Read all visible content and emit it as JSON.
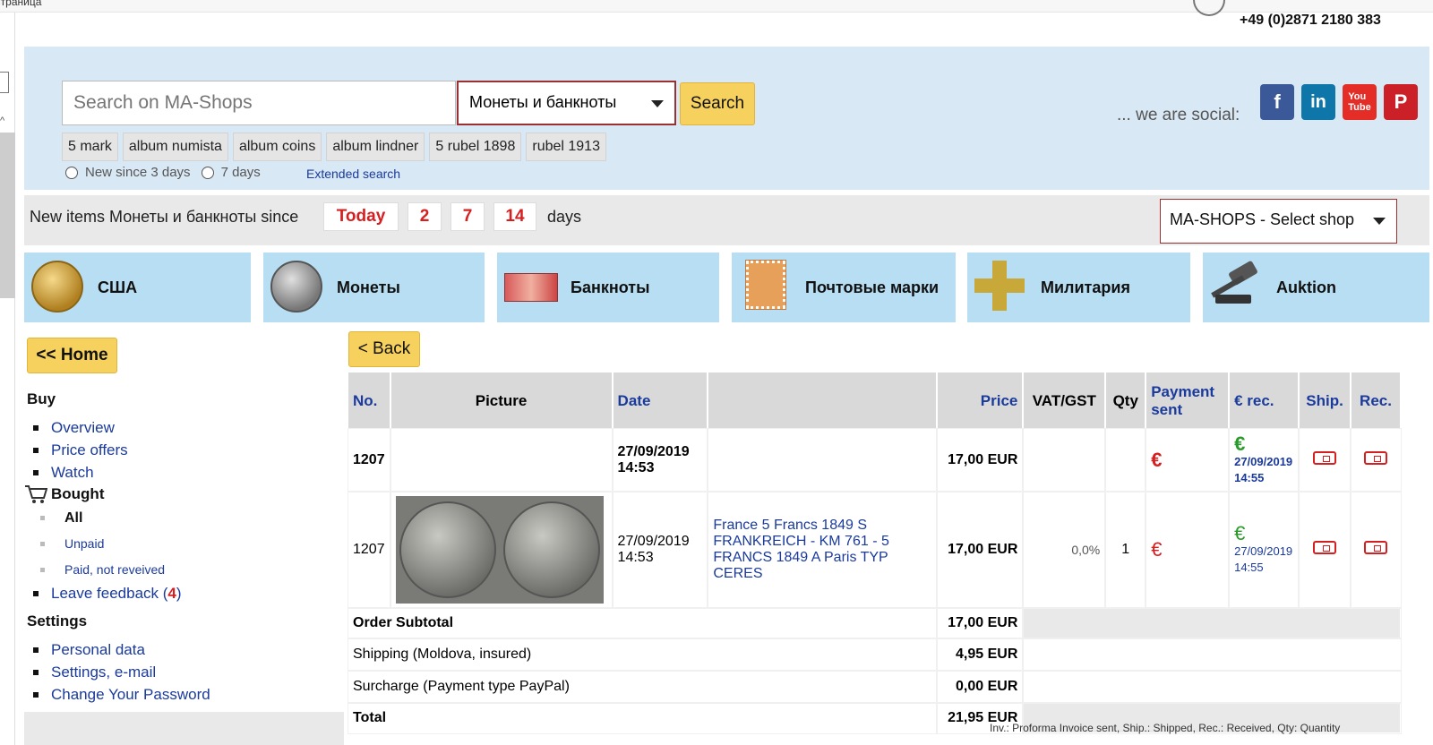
{
  "browser": {
    "tab_title": "Страница"
  },
  "header": {
    "phone": "+49 (0)2871 2180 383"
  },
  "search": {
    "placeholder": "Search on MA-Shops",
    "category": "Монеты и банкноты",
    "button": "Search",
    "tags": [
      "5 mark",
      "album numista",
      "album coins",
      "album lindner",
      "5 rubel 1898",
      "rubel 1913"
    ],
    "radio_1": "New since 3 days",
    "radio_2": "7 days",
    "extended": "Extended search"
  },
  "social": {
    "label": "... we are social:",
    "icons": [
      "facebook-icon",
      "linkedin-icon",
      "youtube-icon",
      "pinterest-icon"
    ]
  },
  "newitems": {
    "text": "New items Монеты и банкноты since",
    "today": "Today",
    "d2": "2",
    "d7": "7",
    "d14": "14",
    "days": "days"
  },
  "shop_select": "MA-SHOPS - Select shop",
  "categories": [
    "США",
    "Монеты",
    "Банкноты",
    "Почтовые марки",
    "Милитария",
    "Auktion"
  ],
  "sidebar": {
    "home": "<< Home",
    "buy": "Buy",
    "overview": "Overview",
    "price_offers": "Price offers",
    "watch": "Watch",
    "bought": "Bought",
    "all": "All",
    "unpaid": "Unpaid",
    "paid_not_received": "Paid, not reveived",
    "leave_feedback": "Leave feedback (",
    "feedback_count": "4",
    "feedback_close": ")",
    "settings": "Settings",
    "personal_data": "Personal data",
    "settings_email": "Settings, e-mail",
    "change_password": "Change Your Password"
  },
  "main": {
    "back": "< Back",
    "columns": {
      "no": "No.",
      "picture": "Picture",
      "date": "Date",
      "desc": "",
      "price": "Price",
      "vat": "VAT/GST",
      "qty": "Qty",
      "payment": "Payment sent",
      "rec": "€ rec.",
      "ship": "Ship.",
      "recd": "Rec."
    },
    "order": {
      "no": "1207",
      "date": "27/09/2019",
      "time": "14:53",
      "price": "17,00 EUR",
      "euro": "€",
      "rec_date": "27/09/2019",
      "rec_time": "14:55"
    },
    "item": {
      "no": "1207",
      "date": "27/09/2019",
      "time": "14:53",
      "title": "France 5 Francs 1849 S FRANKREICH - KM 761 - 5 FRANCS 1849 A Paris TYP CERES",
      "price": "17,00 EUR",
      "vat": "0,0%",
      "qty": "1",
      "euro": "€",
      "rec_date": "27/09/2019",
      "rec_time": "14:55"
    },
    "summary": {
      "subtotal_label": "Order Subtotal",
      "subtotal": "17,00 EUR",
      "shipping_label": "Shipping (Moldova, insured)",
      "shipping": "4,95 EUR",
      "surcharge_label": "Surcharge (Payment type PayPal)",
      "surcharge": "0,00 EUR",
      "total_label": "Total",
      "total": "21,95 EUR"
    },
    "legend": "Inv.: Proforma Invoice sent, Ship.: Shipped, Rec.: Received, Qty: Quantity"
  }
}
